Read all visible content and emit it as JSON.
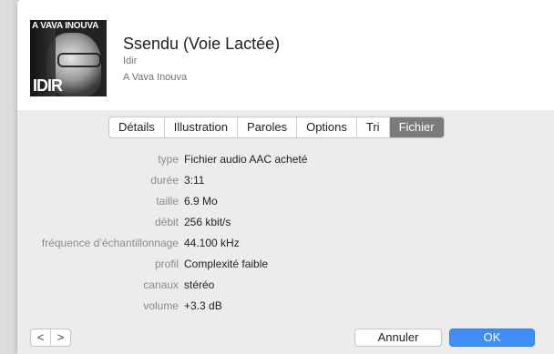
{
  "track": {
    "title": "Ssendu (Voie Lactée)",
    "artist": "Idir",
    "album": "A Vava Inouva"
  },
  "artwork": {
    "top_text": "A VAVA INOUVA",
    "bottom_text": "IDIR"
  },
  "tabs": [
    {
      "label": "Détails"
    },
    {
      "label": "Illustration"
    },
    {
      "label": "Paroles"
    },
    {
      "label": "Options"
    },
    {
      "label": "Tri"
    },
    {
      "label": "Fichier"
    }
  ],
  "selected_tab": "Fichier",
  "file_info": [
    {
      "label": "type",
      "value": "Fichier audio AAC acheté"
    },
    {
      "label": "durée",
      "value": "3:11"
    },
    {
      "label": "taille",
      "value": "6.9 Mo"
    },
    {
      "label": "débit",
      "value": "256 kbit/s"
    },
    {
      "label": "fréquence d’échantillonnage",
      "value": "44.100 kHz"
    },
    {
      "label": "profil",
      "value": "Complexité faible"
    },
    {
      "label": "canaux",
      "value": "stéréo"
    },
    {
      "label": "volume",
      "value": "+3.3 dB"
    }
  ],
  "nav": {
    "prev": "<",
    "next": ">"
  },
  "buttons": {
    "cancel": "Annuler",
    "ok": "OK"
  },
  "colors": {
    "accent": "#3d8ff7",
    "selected_tab": "#7a7a7a"
  }
}
